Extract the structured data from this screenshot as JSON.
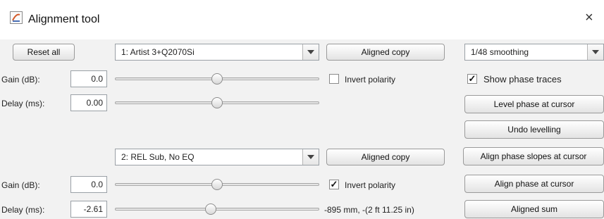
{
  "window": {
    "title": "Alignment tool",
    "close_label": "×"
  },
  "toolbar": {
    "reset_label": "Reset all",
    "smoothing_value": "1/48 smoothing"
  },
  "channel1": {
    "name": "1: Artist 3+Q2070Si",
    "aligned_copy_label": "Aligned copy",
    "gain_label": "Gain (dB):",
    "gain_value": "0.0",
    "delay_label": "Delay (ms):",
    "delay_value": "0.00",
    "invert_label": "Invert polarity",
    "invert_checked": false,
    "gain_slider": 0.5,
    "delay_slider": 0.5
  },
  "channel2": {
    "name": "2: REL Sub, No EQ",
    "aligned_copy_label": "Aligned copy",
    "gain_label": "Gain (dB):",
    "gain_value": "0.0",
    "delay_label": "Delay (ms):",
    "delay_value": "-2.61",
    "invert_label": "Invert polarity",
    "invert_checked": true,
    "delay_readout": "-895 mm, -(2 ft 11.25 in)",
    "gain_slider": 0.5,
    "delay_slider": 0.47
  },
  "right_panel": {
    "show_phase_label": "Show phase traces",
    "show_phase_checked": true,
    "level_phase_label": "Level phase at cursor",
    "undo_levelling_label": "Undo levelling",
    "align_slopes_label": "Align phase slopes at cursor",
    "align_phase_label": "Align phase at cursor",
    "aligned_sum_label": "Aligned sum"
  },
  "icons": {
    "app": "app-icon",
    "close": "close-icon",
    "dropdown": "chevron-down-icon"
  }
}
